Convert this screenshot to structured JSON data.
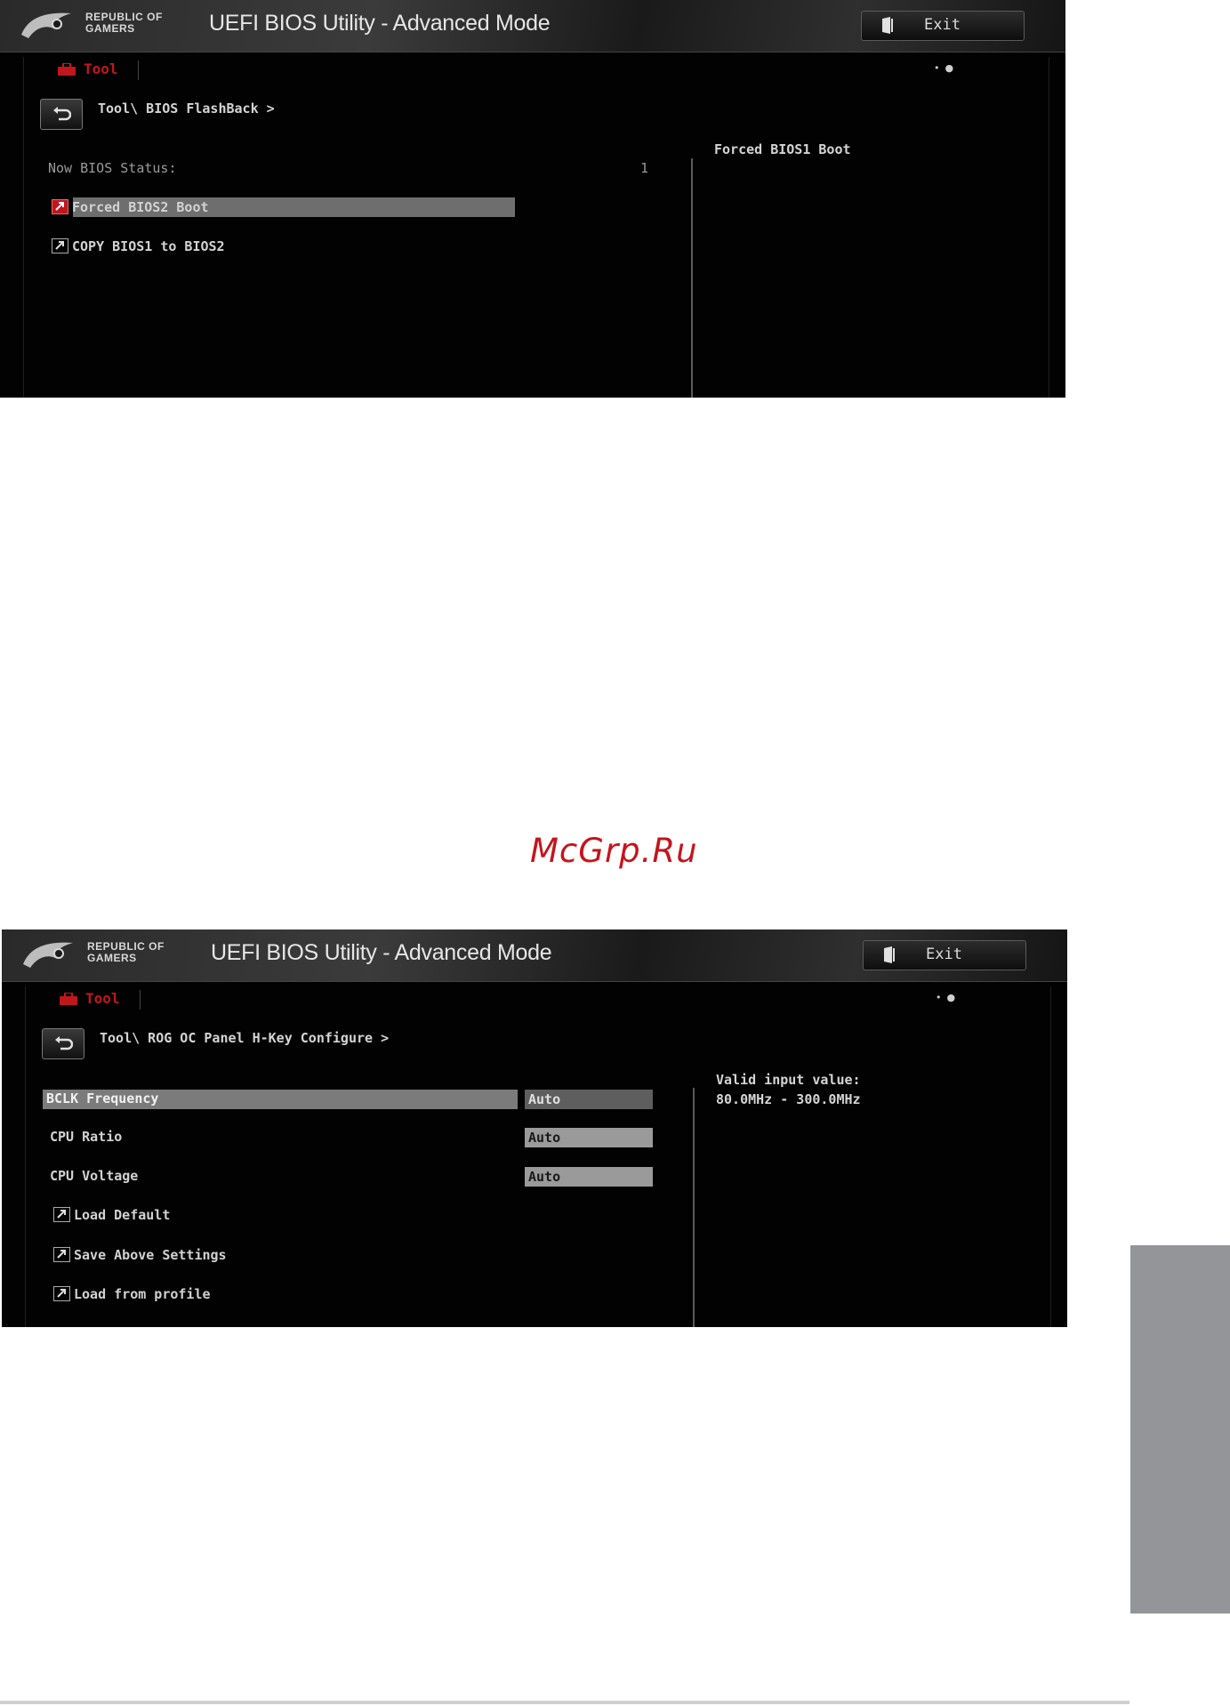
{
  "screens": [
    {
      "brand_line1": "REPUBLIC OF",
      "brand_line2": "GAMERS",
      "title": "UEFI BIOS Utility - Advanced Mode",
      "exit_label": "Exit",
      "tab_label": "Tool",
      "breadcrumb": "Tool\\ BIOS FlashBack >",
      "status_label": "Now BIOS Status:",
      "status_value": "1",
      "items": [
        "Forced BIOS2 Boot",
        "COPY BIOS1 to BIOS2"
      ],
      "help_text": "Forced BIOS1 Boot"
    },
    {
      "brand_line1": "REPUBLIC OF",
      "brand_line2": "GAMERS",
      "title": "UEFI BIOS Utility - Advanced Mode",
      "exit_label": "Exit",
      "tab_label": "Tool",
      "breadcrumb": "Tool\\ ROG OC Panel H-Key Configure >",
      "settings": [
        {
          "label": "BCLK Frequency",
          "value": "Auto"
        },
        {
          "label": "CPU Ratio",
          "value": "Auto"
        },
        {
          "label": "CPU Voltage",
          "value": "Auto"
        }
      ],
      "actions": [
        "Load Default",
        "Save Above Settings",
        "Load from profile"
      ],
      "help_line1": "Valid input value:",
      "help_line2": "80.0MHz - 300.0MHz"
    }
  ],
  "watermark": "McGrp.Ru",
  "colors": {
    "accent_red": "#c0171d",
    "highlight_gray": "#6e6e6e",
    "side_tab_gray": "#939598"
  }
}
